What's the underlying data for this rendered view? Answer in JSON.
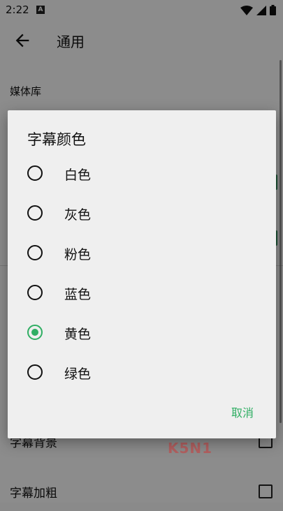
{
  "status_bar": {
    "time": "2:22",
    "notification_icon_letter": "A",
    "icons": [
      "wifi-icon",
      "signal-icon",
      "battery-icon"
    ]
  },
  "app_bar": {
    "title": "通用",
    "back_icon": "arrow-left-icon"
  },
  "settings": {
    "section_header": "媒体库",
    "rows": [
      {
        "label": "字幕背景",
        "checked": false
      },
      {
        "label": "字幕加粗",
        "checked": false
      }
    ]
  },
  "dialog": {
    "title": "字幕颜色",
    "options": [
      {
        "label": "白色",
        "selected": false
      },
      {
        "label": "灰色",
        "selected": false
      },
      {
        "label": "粉色",
        "selected": false
      },
      {
        "label": "蓝色",
        "selected": false
      },
      {
        "label": "黄色",
        "selected": true
      },
      {
        "label": "绿色",
        "selected": false
      }
    ],
    "cancel_label": "取消"
  },
  "watermark": "K5N1",
  "colors": {
    "accent": "#2fae63",
    "scrim": "#000000"
  }
}
